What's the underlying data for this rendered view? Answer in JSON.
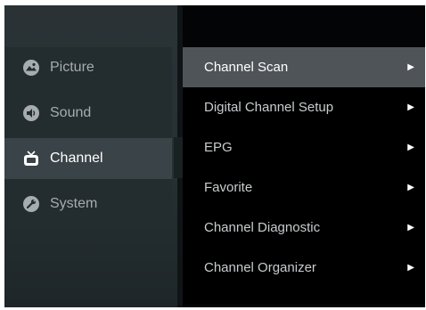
{
  "left_menu": {
    "items": [
      {
        "label": "Picture",
        "icon": "picture-icon"
      },
      {
        "label": "Sound",
        "icon": "sound-icon"
      },
      {
        "label": "Channel",
        "icon": "channel-icon",
        "active": true
      },
      {
        "label": "System",
        "icon": "system-icon"
      }
    ]
  },
  "right_menu": {
    "items": [
      {
        "label": "Channel Scan",
        "active": true
      },
      {
        "label": "Digital Channel Setup"
      },
      {
        "label": "EPG"
      },
      {
        "label": "Favorite"
      },
      {
        "label": "Channel Diagnostic"
      },
      {
        "label": "Channel Organizer"
      }
    ],
    "arrow_glyph": "▶"
  },
  "colors": {
    "active_left_bg": "#3a4347",
    "active_right_bg": "#4e5458",
    "text_inactive": "#a7adae",
    "text_active": "#ffffff"
  }
}
